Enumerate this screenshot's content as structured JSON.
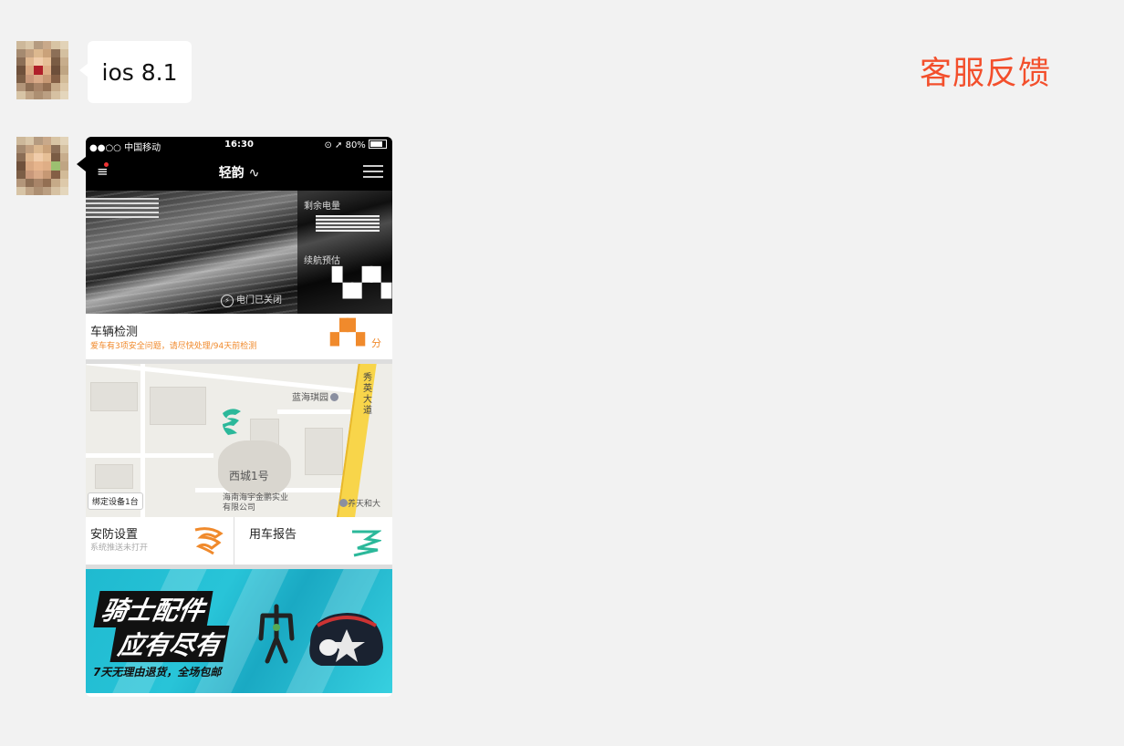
{
  "feedback_label": "客服反馈",
  "message1": {
    "text": "ios 8.1"
  },
  "phone": {
    "status": {
      "carrier": "●●○○ 中国移动",
      "time": "16:30",
      "right": "80%"
    },
    "nav": {
      "title": "轻韵"
    },
    "hero": {
      "battery_label": "剩余电量",
      "range_label": "续航预估",
      "door_status": "电门已关闭"
    },
    "check": {
      "title": "车辆检测",
      "subtitle": "爱车有3项安全问题，请尽快处理/94天前检测",
      "unit": "分"
    },
    "map": {
      "labels": {
        "park": "蓝海琪园",
        "road": "秀英大道",
        "block": "西城1号",
        "company": "海南海宇金鹏实业有限公司",
        "store": "养天和大"
      },
      "bind_button": "绑定设备1台"
    },
    "tiles": [
      {
        "title": "安防设置",
        "subtitle": "系统推送未打开"
      },
      {
        "title": "用车报告"
      }
    ],
    "banner": {
      "line1": "骑士配件",
      "line2": "应有尽有",
      "sub": "7天无理由退货，全场包邮"
    }
  },
  "colors": {
    "accent": "#f34f2c",
    "orange": "#f08a2c",
    "teal": "#1fbad0",
    "map_green": "#2bb89a"
  }
}
